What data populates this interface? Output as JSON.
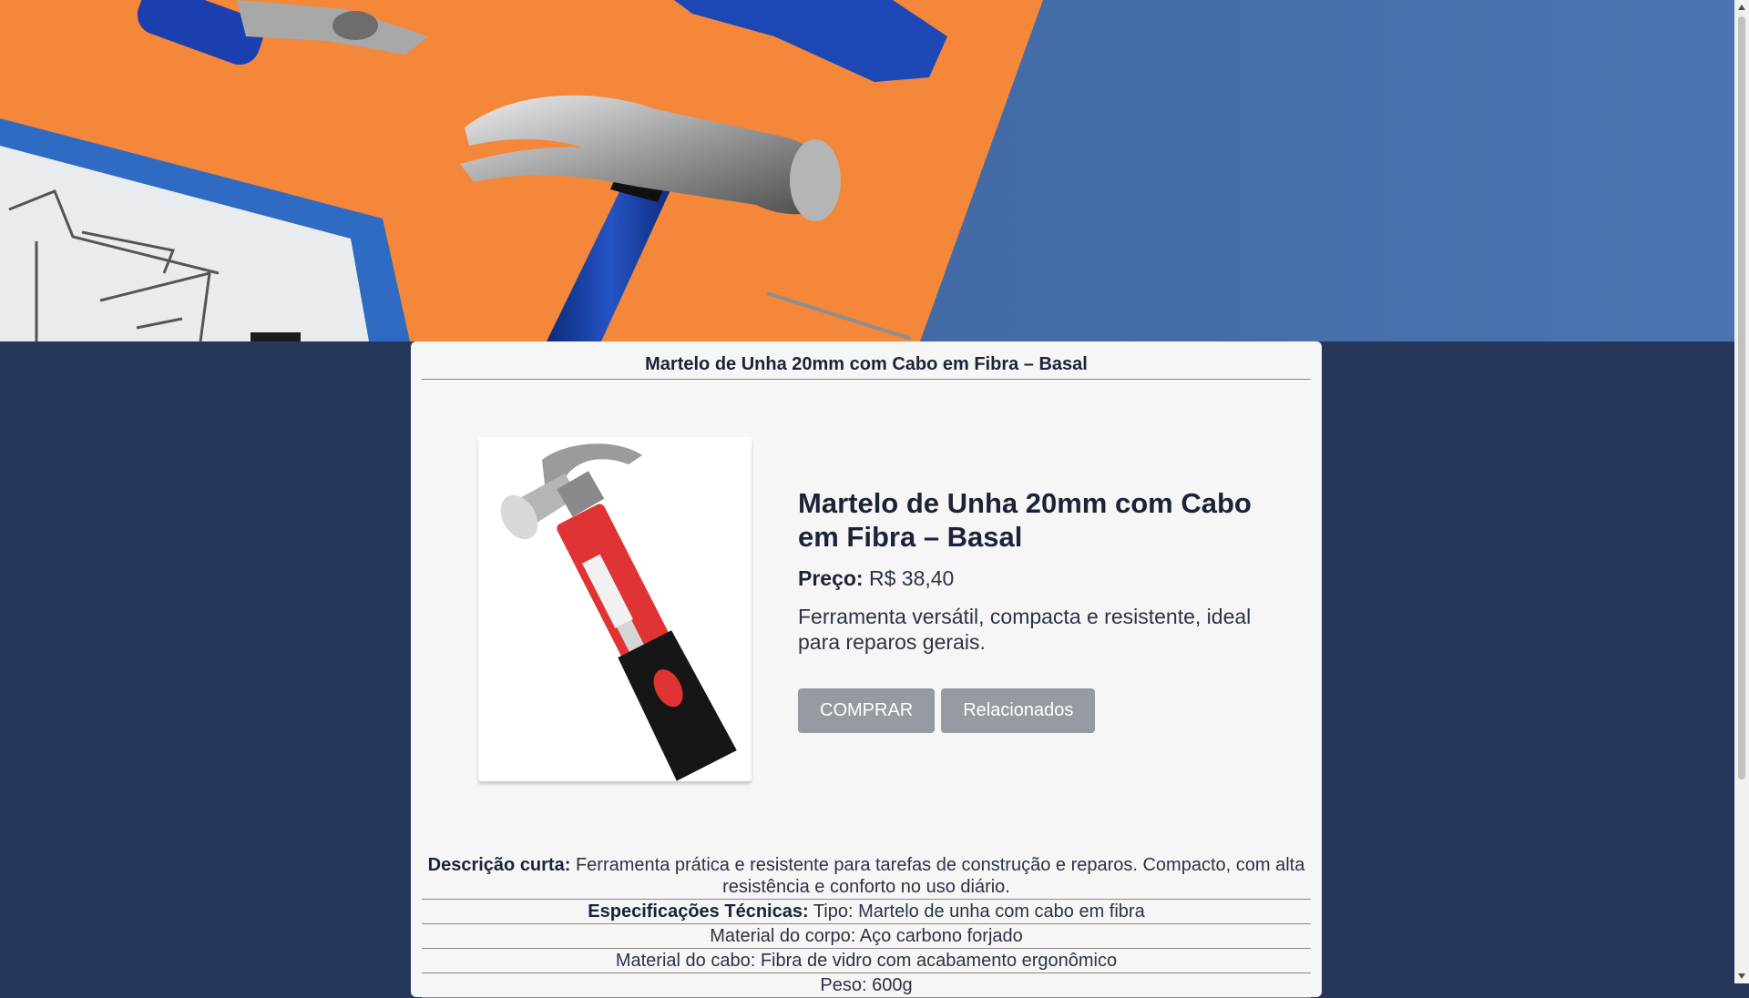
{
  "product": {
    "page_title": "Martelo de Unha 20mm com Cabo em Fibra – Basal",
    "name": "Martelo de Unha 20mm com Cabo em Fibra – Basal",
    "price_label": "Preço:",
    "price_value": "R$ 38,40",
    "summary": "Ferramenta versátil, compacta e resistente, ideal para reparos gerais.",
    "buttons": {
      "buy": "COMPRAR",
      "related": "Relacionados"
    }
  },
  "details": {
    "short_description_label": "Descrição curta:",
    "short_description_text": "Ferramenta prática e resistente para tarefas de construção e reparos. Compacto, com alta resistência e conforto no uso diário.",
    "specs_label": "Especificações Técnicas:",
    "specs": [
      "Tipo: Martelo de unha com cabo em fibra",
      "Material do corpo: Aço carbono forjado",
      "Material do cabo: Fibra de vidro com acabamento ergonômico",
      "Peso: 600g"
    ]
  },
  "icons": {
    "scroll_up": "chevron-up-icon",
    "scroll_down": "chevron-down-icon"
  },
  "colors": {
    "page_background": "#27375c",
    "card_background": "#f6f6f6",
    "button_background": "#959ba1",
    "banner_orange": "#f5873a",
    "banner_blue": "#3f66a0"
  }
}
